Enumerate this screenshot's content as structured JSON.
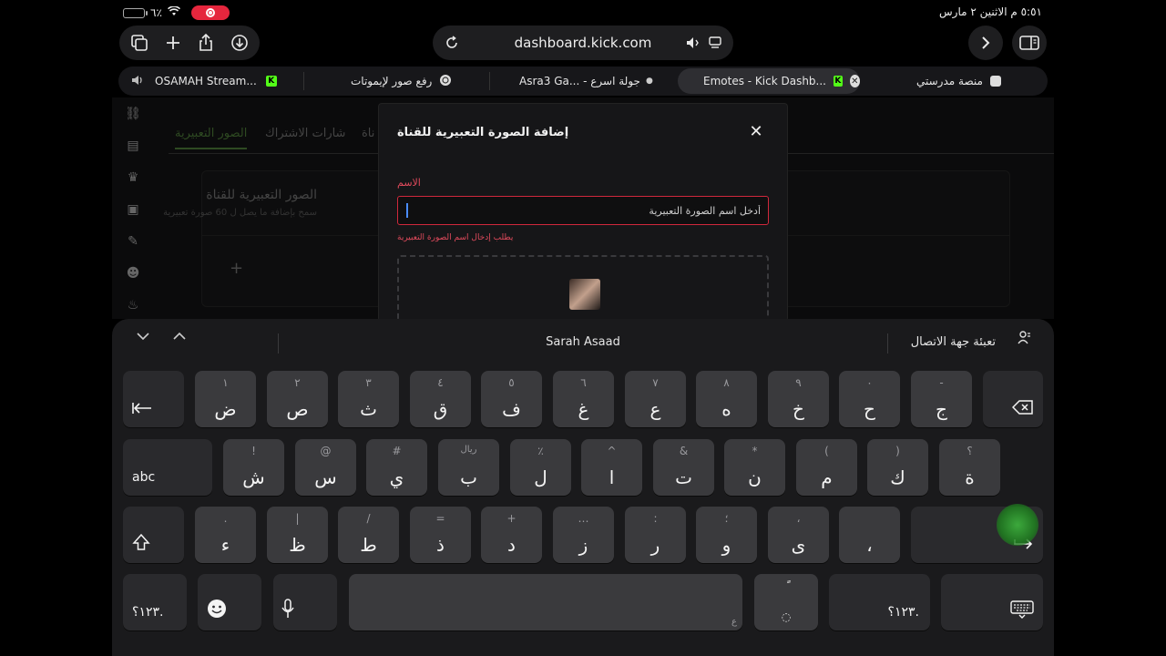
{
  "status": {
    "time_date": "٥:٥١ م   الاثنين ٢ مارس",
    "battery_pct": "٦٪"
  },
  "toolbar": {
    "url": "dashboard.kick.com"
  },
  "tabs": [
    {
      "label": "OSAMAH Stream..."
    },
    {
      "label": "رفع صور لإيموتات"
    },
    {
      "label": "Asra3 Ga... - جولة اسرع"
    },
    {
      "label": "Emotes - Kick Dashb..."
    },
    {
      "label": "منصة مدرستي"
    }
  ],
  "page": {
    "tabs": [
      "الصور التعبيرية",
      "شارات الاشتراك",
      "ناة"
    ],
    "card_title": "الصور التعبيرية للقناة",
    "card_subtitle": "سمح بإضافة ما يصل ل 60 صورة تعبيرية",
    "add_label": "+"
  },
  "modal": {
    "title": "إضافة الصورة التعبيرية للقناة",
    "close": "✕",
    "name_label": "الاسم",
    "name_placeholder": "أدخل اسم الصورة التعبيرية",
    "error": "يطلب إدخال اسم الصورة التعبيرية"
  },
  "keyboard": {
    "suggestion_center": "Sarah Asaad",
    "suggestion_right": "تعبئة جهة الاتصال",
    "row1": [
      {
        "alt": "١",
        "main": "ض"
      },
      {
        "alt": "٢",
        "main": "ص"
      },
      {
        "alt": "٣",
        "main": "ث"
      },
      {
        "alt": "٤",
        "main": "ق"
      },
      {
        "alt": "٥",
        "main": "ف"
      },
      {
        "alt": "٦",
        "main": "غ"
      },
      {
        "alt": "٧",
        "main": "ع"
      },
      {
        "alt": "٨",
        "main": "ه"
      },
      {
        "alt": "٩",
        "main": "خ"
      },
      {
        "alt": "٠",
        "main": "ح"
      },
      {
        "alt": "-",
        "main": "ج"
      }
    ],
    "row2": [
      {
        "alt": "!",
        "main": "ش"
      },
      {
        "alt": "@",
        "main": "س"
      },
      {
        "alt": "#",
        "main": "ي"
      },
      {
        "alt": "ريال",
        "main": "ب"
      },
      {
        "alt": "٪",
        "main": "ل"
      },
      {
        "alt": "^",
        "main": "ا"
      },
      {
        "alt": "&",
        "main": "ت"
      },
      {
        "alt": "*",
        "main": "ن"
      },
      {
        "alt": "(",
        "main": "م"
      },
      {
        "alt": ")",
        "main": "ك"
      },
      {
        "alt": "؟",
        "main": "ة"
      }
    ],
    "row3": [
      {
        "alt": ".",
        "main": "ء"
      },
      {
        "alt": "|",
        "main": "ظ"
      },
      {
        "alt": "/",
        "main": "ط"
      },
      {
        "alt": "=",
        "main": "ذ"
      },
      {
        "alt": "+",
        "main": "د"
      },
      {
        "alt": "…",
        "main": "ز"
      },
      {
        "alt": ":",
        "main": "ر"
      },
      {
        "alt": "؛",
        "main": "و"
      },
      {
        "alt": "،",
        "main": "ى"
      },
      {
        "alt": "",
        "main": "،"
      }
    ],
    "abc_label": "abc",
    "numbers_label": "١٢٣؟.",
    "diacritic": "ًً",
    "space_hint": "ع"
  }
}
